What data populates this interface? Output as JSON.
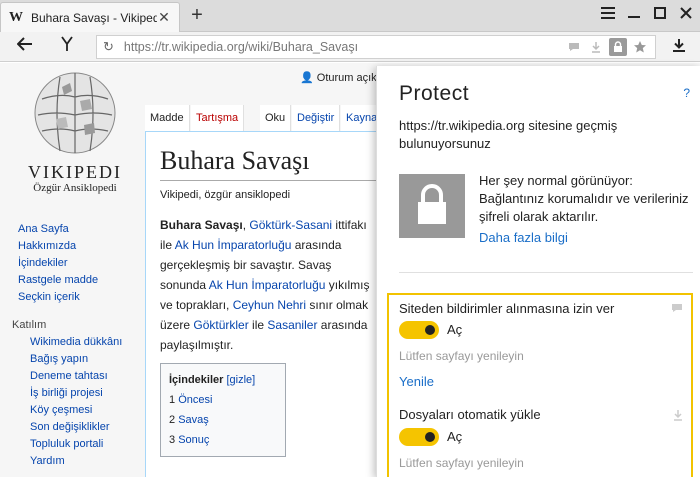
{
  "browser": {
    "tab_favicon": "W",
    "tab_title": "Buhara Savaşı - Vikipedi",
    "tab_close": "✕",
    "new_tab": "+",
    "url": "https://tr.wikipedia.org/wiki/Buhara_Savaşı",
    "icons": [
      "back-icon",
      "yandex-icon",
      "reload-icon",
      "chat-icon",
      "download-icon",
      "lock-icon",
      "star-icon",
      "downloads-icon",
      "menu-icon",
      "minimize-icon",
      "maximize-icon",
      "close-icon"
    ]
  },
  "wiki": {
    "name": "VIKIPEDI",
    "slogan": "Özgür Ansiklopedi",
    "user": "Oturum açık",
    "tabs": [
      "Madde",
      "Tartışma",
      "Oku",
      "Değiştir",
      "Kayna"
    ],
    "nav": [
      "Ana Sayfa",
      "Hakkımızda",
      "İçindekiler",
      "Rastgele madde",
      "Seçkin içerik"
    ],
    "participation_heading": "Katılım",
    "participation": [
      "Wikimedia dükkânı",
      "Bağış yapın",
      "Deneme tahtası",
      "İş birliği projesi",
      "Köy çeşmesi",
      "Son değişiklikler",
      "Topluluk portali",
      "Yardım"
    ],
    "article": {
      "title": "Buhara Savaşı",
      "from": "Vikipedi, özgür ansiklopedi",
      "bold": "Buhara Savaşı",
      "t1": ", ",
      "l1": "Göktürk-Sasani",
      "t2": " ittifakı ile ",
      "l2": "Ak Hun İmparatorluğu",
      "t3": " arasında gerçekleşmiş bir savaştır. Savaş sonunda ",
      "l3": "Ak Hun İmparatorluğu",
      "t4": " yıkılmış ve toprakları, ",
      "l4": "Ceyhun Nehri",
      "t5": " sınır olmak üzere ",
      "l5": "Göktürkler",
      "t6": " ile ",
      "l6": "Sasaniler",
      "t7": " arasında paylaşılmıştır."
    },
    "toc": {
      "title": "İçindekiler",
      "toggle": "[gizle]",
      "items": [
        {
          "num": "1",
          "label": "Öncesi"
        },
        {
          "num": "2",
          "label": "Savaş"
        },
        {
          "num": "3",
          "label": "Sonuç"
        }
      ]
    }
  },
  "protect": {
    "title": "Protect",
    "help": "?",
    "site_message": "https://tr.wikipedia.org sitesine geçmiş bulunuyorsunuz",
    "status": "Her şey normal görünüyor: Bağlantınız korumalıdır ve verileriniz şifreli olarak aktarılır.",
    "more_link": "Daha fazla bilgi",
    "permissions": [
      {
        "label": "Siteden bildirimler alınmasına izin ver",
        "state": "Aç",
        "hint": "Lütfen sayfayı yenileyin",
        "action": "Yenile",
        "icon": "chat-icon"
      },
      {
        "label": "Dosyaları otomatik yükle",
        "state": "Aç",
        "hint": "Lütfen sayfayı yenileyin",
        "icon": "download-icon"
      }
    ],
    "accent": "#f2c300",
    "link_color": "#1a6ec8"
  }
}
